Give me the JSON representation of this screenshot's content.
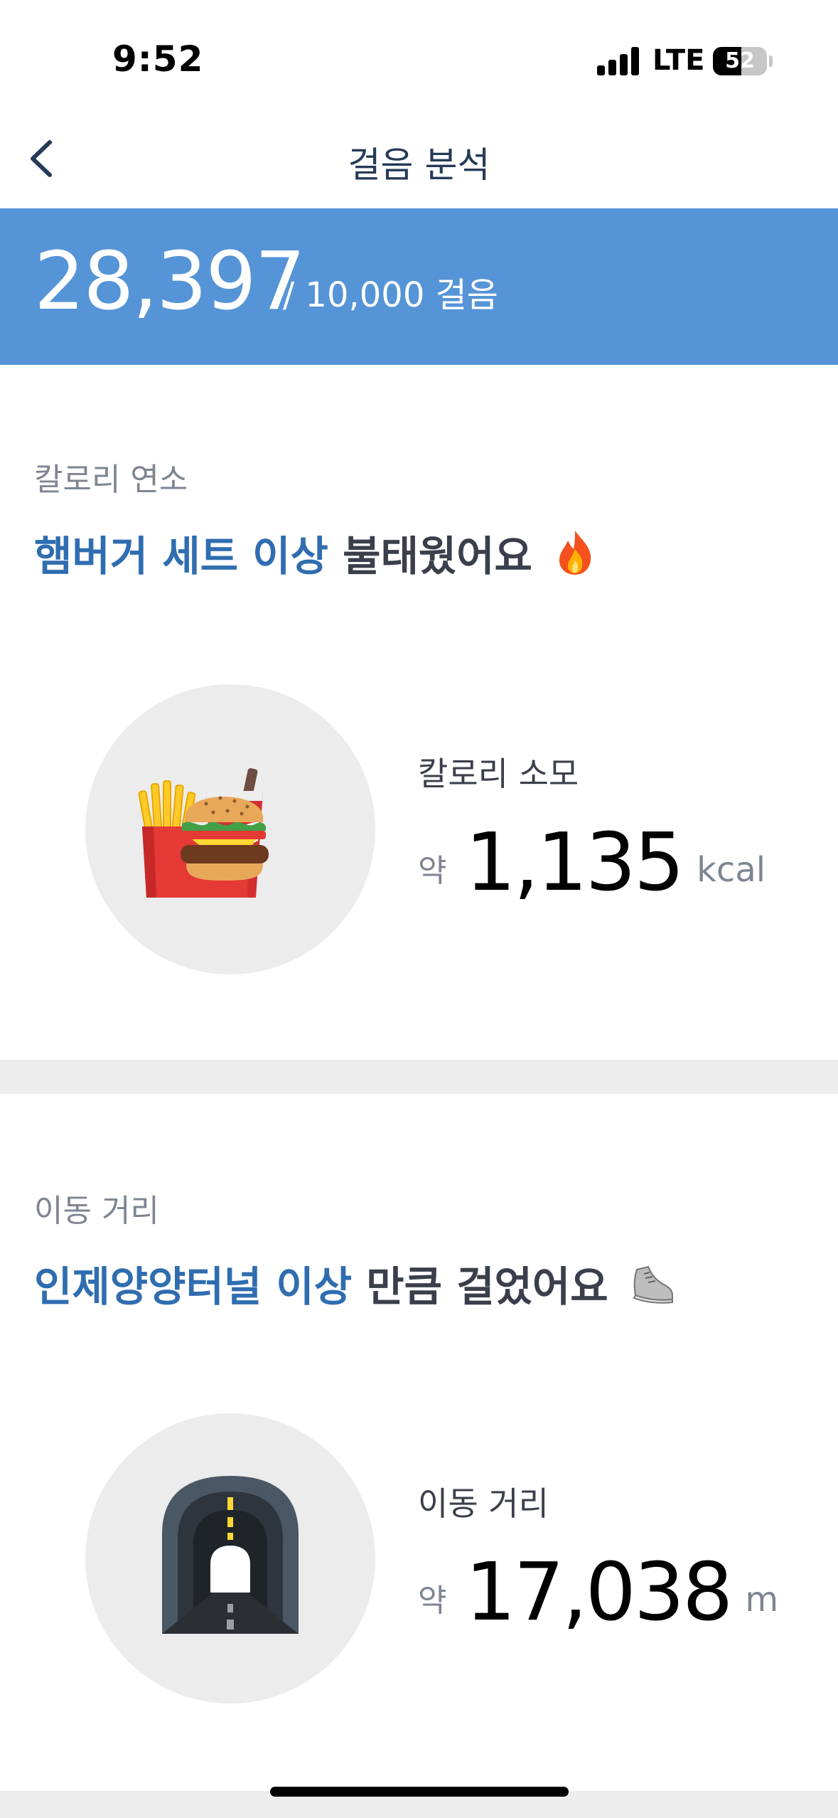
{
  "status_bar": {
    "time": "9:52",
    "network": "LTE",
    "battery_percent": 52
  },
  "nav": {
    "title": "걸음 분석",
    "back_icon": "chevron-left-icon"
  },
  "steps": {
    "count": "28,397",
    "goal_text": "/ 10,000 걸음"
  },
  "calorie_section": {
    "label": "칼로리 연소",
    "headline_highlight": "햄버거 세트 이상",
    "headline_rest": "불태웠어요",
    "headline_icon": "fire-icon",
    "illustration_icon": "burger-set-icon",
    "metric_label": "칼로리 소모",
    "approx": "약",
    "value": "1,135",
    "unit": "kcal"
  },
  "distance_section": {
    "label": "이동 거리",
    "headline_highlight": "인제양양터널 이상",
    "headline_rest": "만큼 걸었어요",
    "headline_icon": "sneaker-icon",
    "illustration_icon": "tunnel-icon",
    "metric_label": "이동 거리",
    "approx": "약",
    "value": "17,038",
    "unit": "m"
  },
  "colors": {
    "banner": "#5594d6",
    "highlight": "#2f6db0",
    "title": "#253a57"
  }
}
